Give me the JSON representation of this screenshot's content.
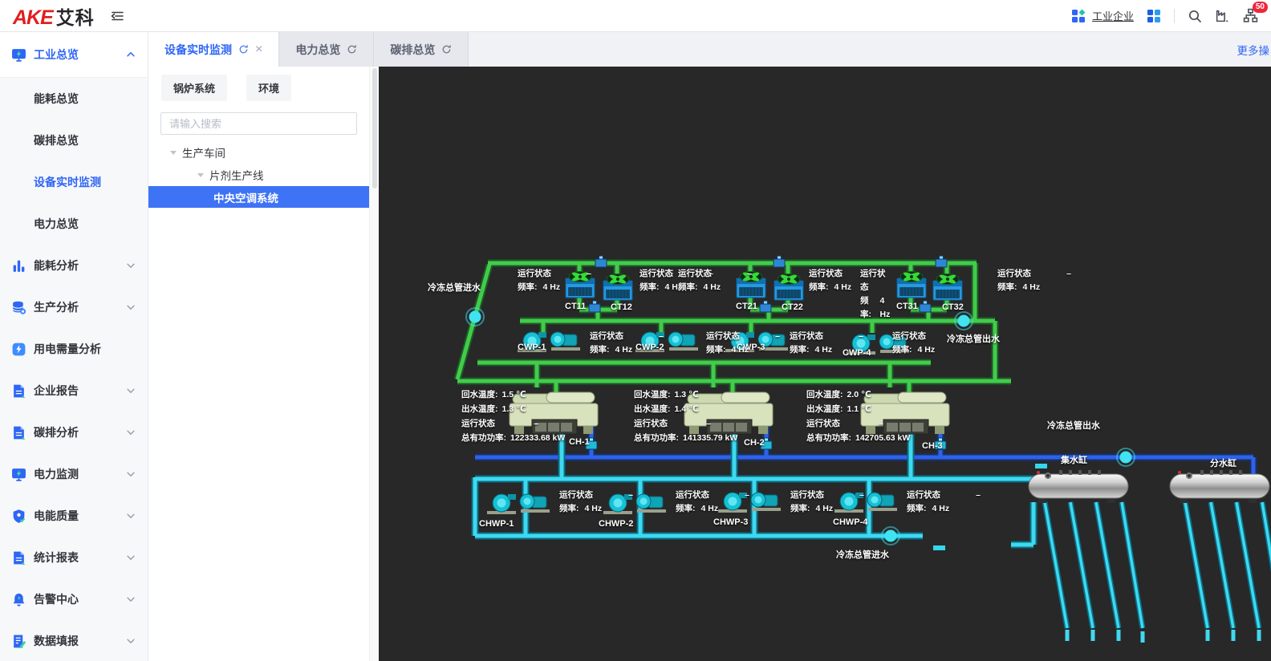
{
  "header": {
    "logo_red": "AKE",
    "logo_black": "艾科",
    "nav_link": "工业企业",
    "badge": "50"
  },
  "sidebar": {
    "group_label": "工业总览",
    "sub_items": [
      "能耗总览",
      "碳排总览",
      "设备实时监测",
      "电力总览"
    ],
    "groups": [
      "能耗分析",
      "生产分析",
      "用电需量分析",
      "企业报告",
      "碳排分析",
      "电力监测",
      "电能质量",
      "统计报表",
      "告警中心",
      "数据填报"
    ]
  },
  "tabs": {
    "items": [
      {
        "label": "设备实时监测"
      },
      {
        "label": "电力总览"
      },
      {
        "label": "碳排总览"
      }
    ],
    "more": "更多操"
  },
  "chips": [
    "锅炉系统",
    "环境"
  ],
  "search": {
    "placeholder": "请输入搜索"
  },
  "tree": {
    "node1": "生产车间",
    "node2": "片剂生产线",
    "selected": "中央空调系统"
  },
  "scada": {
    "status_label": "运行状态",
    "status_value": "–",
    "freq_label": "频率:",
    "freq_value": "4 Hz",
    "labels": {
      "inlet_left": "冷冻总管进水",
      "outlet_green": "冷冻总管出水",
      "outlet_blue": "冷冻总管出水",
      "inlet_bottom": "冷冻总管进水",
      "collector": "集水缸",
      "distributor": "分水缸"
    },
    "towers": [
      {
        "id": "CT11"
      },
      {
        "id": "CT12"
      },
      {
        "id": "CT21"
      },
      {
        "id": "CT22"
      },
      {
        "id": "CT31"
      },
      {
        "id": "CT32"
      }
    ],
    "cwp": [
      {
        "id": "CWP-1"
      },
      {
        "id": "CWP-2"
      },
      {
        "id": "CWP-3"
      },
      {
        "id": "CWP-4"
      }
    ],
    "chwp": [
      {
        "id": "CHWP-1"
      },
      {
        "id": "CHWP-2"
      },
      {
        "id": "CHWP-3"
      },
      {
        "id": "CHWP-4"
      }
    ],
    "chiller_labels": {
      "return": "回水温度:",
      "supply": "出水温度:",
      "status": "运行状态",
      "power": "总有功功率:"
    },
    "chillers": [
      {
        "id": "CH-1",
        "return_temp": "1.5 ℃",
        "supply_temp": "1.3 ℃",
        "power": "122333.68 kW"
      },
      {
        "id": "CH-2",
        "return_temp": "1.3 ℃",
        "supply_temp": "1.4 ℃",
        "power": "141335.79 kW"
      },
      {
        "id": "CH-3",
        "return_temp": "2.0 ℃",
        "supply_temp": "1.1 ℃",
        "power": "142705.63 kW"
      }
    ]
  },
  "colors": {
    "accent": "#2e66f5",
    "pipe_green": "#43cb4c",
    "pipe_cyan": "#3fd9ef",
    "pipe_blue": "#2e63e8",
    "badge_red": "#f0263c",
    "scada_bg": "#282828"
  }
}
